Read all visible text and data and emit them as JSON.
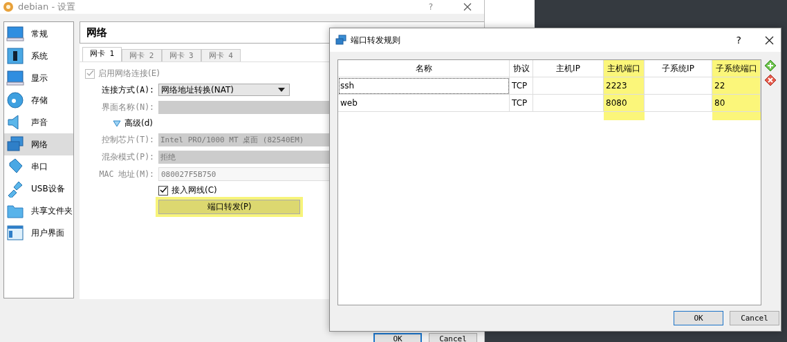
{
  "main_window": {
    "title": "debian - 设置",
    "help": "?"
  },
  "sidebar": {
    "items": [
      {
        "label": "常规",
        "selected": false
      },
      {
        "label": "系统",
        "selected": false
      },
      {
        "label": "显示",
        "selected": false
      },
      {
        "label": "存储",
        "selected": false
      },
      {
        "label": "声音",
        "selected": false
      },
      {
        "label": "网络",
        "selected": true
      },
      {
        "label": "串口",
        "selected": false
      },
      {
        "label": "USB设备",
        "selected": false
      },
      {
        "label": "共享文件夹",
        "selected": false
      },
      {
        "label": "用户界面",
        "selected": false
      }
    ]
  },
  "panel": {
    "title": "网络",
    "tabs": [
      {
        "label": "网卡 1",
        "selected": true
      },
      {
        "label": "网卡 2",
        "selected": false
      },
      {
        "label": "网卡 3",
        "selected": false
      },
      {
        "label": "网卡 4",
        "selected": false
      }
    ],
    "enable": {
      "label": "启用网络连接(E)",
      "checked": true,
      "disabled": true
    },
    "fields": [
      {
        "kind": "select",
        "label": "连接方式(A):",
        "value": "网络地址转换(NAT)",
        "disabled": false
      },
      {
        "kind": "combo",
        "label": "界面名称(N):",
        "disabled": true
      },
      {
        "kind": "expander",
        "label": "高级(d)",
        "expanded": true
      },
      {
        "kind": "combo",
        "label": "控制芯片(T):",
        "value": "Intel PRO/1000 MT 桌面 (82540EM)",
        "disabled": true
      },
      {
        "kind": "combo",
        "label": "混杂模式(P):",
        "value": "拒绝",
        "disabled": true
      },
      {
        "kind": "text",
        "label": "MAC 地址(M):",
        "value": "080027F5B750",
        "disabled": true
      }
    ],
    "cable": {
      "label": "接入网线(C)",
      "checked": true
    },
    "port_forward_button": {
      "label": "端口转发(P)",
      "highlighted": true
    }
  },
  "main_buttons": [
    {
      "label": "OK",
      "default": true
    },
    {
      "label": "Cancel",
      "default": false
    }
  ],
  "dialog": {
    "title": "端口转发规则",
    "help": "?",
    "columns": [
      {
        "label": "名称",
        "highlighted": false
      },
      {
        "label": "协议",
        "highlighted": false
      },
      {
        "label": "主机IP",
        "highlighted": false
      },
      {
        "label": "主机端口",
        "highlighted": true
      },
      {
        "label": "子系统IP",
        "highlighted": false
      },
      {
        "label": "子系统端口",
        "highlighted": true
      }
    ],
    "rows": [
      {
        "name": "ssh",
        "protocol": "TCP",
        "host_port": "2223",
        "guest_port": "22",
        "focused": true
      },
      {
        "name": "web",
        "protocol": "TCP",
        "host_port": "8080",
        "guest_port": "80",
        "focused": false
      }
    ],
    "buttons": [
      {
        "label": "OK",
        "default": true
      },
      {
        "label": "Cancel",
        "default": false
      }
    ]
  }
}
